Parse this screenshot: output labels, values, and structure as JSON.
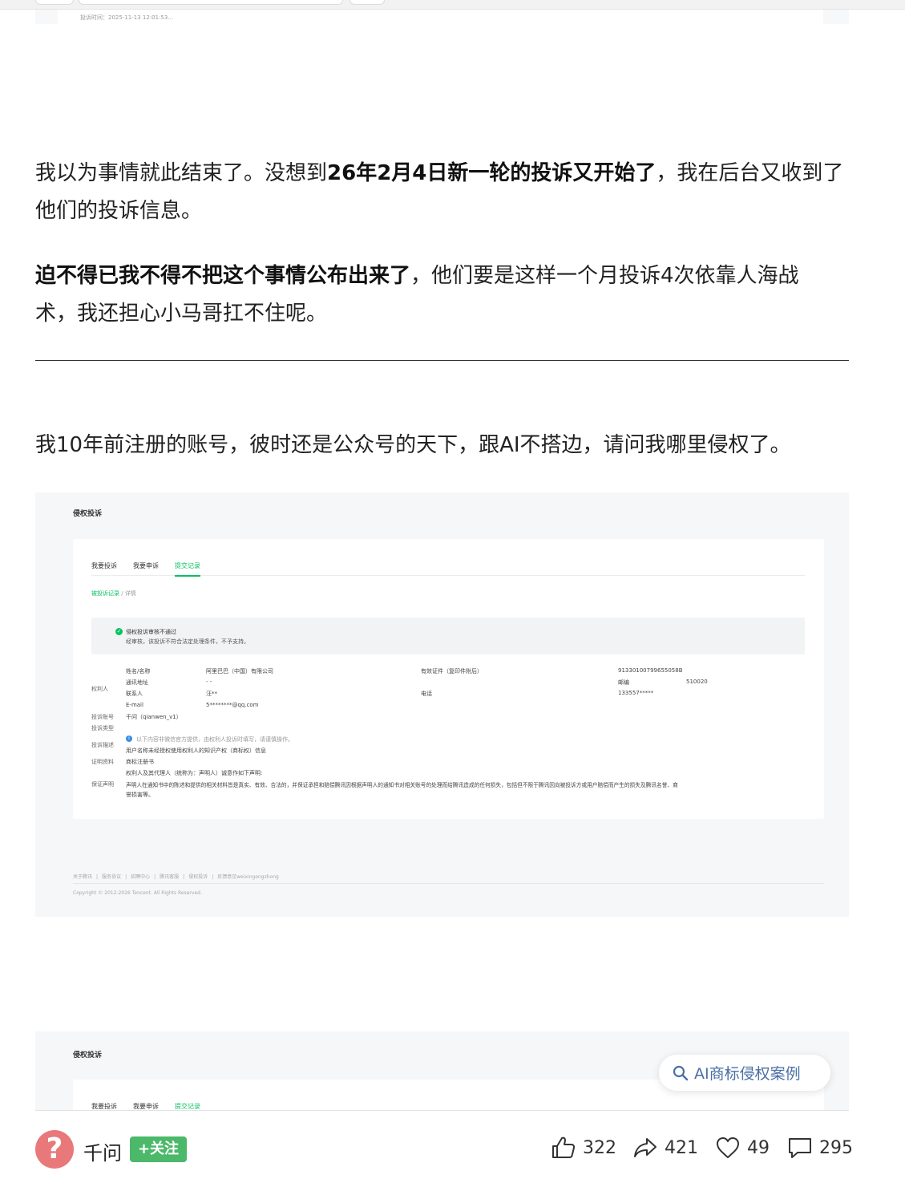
{
  "top_card": {
    "time": "投诉时间：2025-11-13 12:01:53..."
  },
  "article": {
    "p1": {
      "before": "我以为事情就此结束了。没想到",
      "bold": "26年2月4日新一轮的投诉又开始了",
      "after": "，我在后台又收到了他们的投诉信息。"
    },
    "p2": {
      "bold": "迫不得已我不得不把这个事情公布出来了",
      "after": "，他们要是这样一个月投诉4次依靠人海战术，我还担心小马哥扛不住呢。"
    },
    "p3": "我10年前注册的账号，彼时还是公众号的天下，跟AI不搭边，请问我哪里侵权了。"
  },
  "shot1": {
    "title": "侵权投诉",
    "tabs": [
      "我要投诉",
      "我要申诉",
      "提交记录"
    ],
    "breadcrumb": {
      "link": "被投诉记录",
      "sep": " / ",
      "current": "详情"
    },
    "status": {
      "title": "侵权投诉审核不通过",
      "desc": "经审核，该投诉不符合法定处理条件，不予支持。"
    },
    "rights_holder_label": "权利人",
    "fields": {
      "name_label": "姓名/名称",
      "name_value": "阿里巴巴（中国）有限公司",
      "address_label": "通讯地址",
      "address_value": "- -",
      "contact_label": "联系人",
      "contact_value": "汪**",
      "email_label": "E-mail",
      "email_value": "5********@qq.com",
      "cert_label": "有效证件（复印件附后）",
      "cert_value": "91330100799655058B",
      "zip_label": "邮编",
      "zip_value": "510020",
      "phone_label": "电话",
      "phone_value": "133557*****",
      "account_label": "投诉账号",
      "account_value": "千问（qianwen_v1）",
      "type_label": "投诉类型",
      "desc_label": "投诉描述",
      "desc_notice": "以下内容非微信官方提供，由权利人投诉时填写，请谨慎操作。",
      "desc_value": "用户名称未经授权使用权利人的知识产权（商标权）信息",
      "proof_label": "证明资料",
      "proof_value": "商标注册书",
      "guarantee_label": "保证声明",
      "guarantee_line1": "权利人及其代理人（统称为：声明人）诚意作如下声明:",
      "guarantee_line2": "声明人在通知书中的陈述和提供的相关材料皆是真实、有效、合法的，并保证承担和赔偿腾讯因根据声明人的通知书对相关账号的处理而给腾讯造成的任何损失，包括但不限于腾讯因向被投诉方或用户赔偿而产生的损失及腾讯名誉、商",
      "guarantee_line3": "誉损害等。"
    },
    "footer_links": [
      "关于腾讯",
      "|",
      "服务协议",
      "|",
      "招聘中心",
      "|",
      "腾讯客服",
      "|",
      "侵权投诉",
      "|",
      "反馈意见weixingongzhong"
    ],
    "copyright": "Copyright © 2012-2026 Tencent. All Rights Reserved."
  },
  "shot2": {
    "title": "侵权投诉",
    "tabs": [
      "我要投诉",
      "我要申诉",
      "提交记录"
    ]
  },
  "ai_chip": {
    "label": "AI商标侵权案例",
    "icon": "search-icon"
  },
  "bottom": {
    "avatar_glyph": "?",
    "author": "千问",
    "follow": "+关注",
    "likes": "322",
    "shares": "421",
    "favorites": "49",
    "comments": "295"
  },
  "colors": {
    "accent_green": "#07c160",
    "follow_green": "#4bb86a",
    "avatar": "#e8787a",
    "ai_text": "#4a6fa5"
  }
}
